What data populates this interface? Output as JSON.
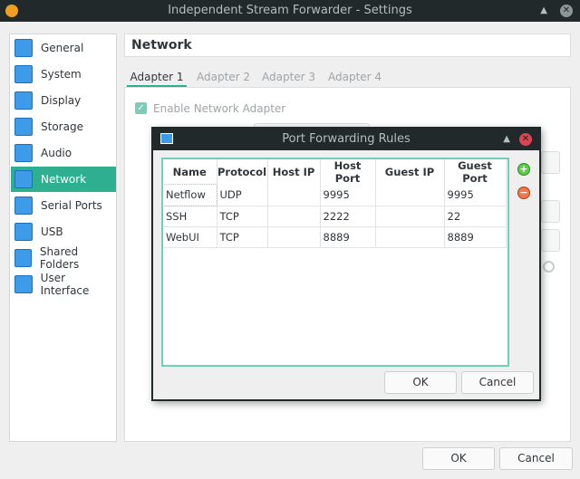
{
  "window": {
    "title": "Independent Stream Forwarder - Settings"
  },
  "sidebar": {
    "items": [
      {
        "label": "General",
        "icon": "general-icon"
      },
      {
        "label": "System",
        "icon": "chip-icon"
      },
      {
        "label": "Display",
        "icon": "monitor-icon"
      },
      {
        "label": "Storage",
        "icon": "storage-icon"
      },
      {
        "label": "Audio",
        "icon": "speaker-icon"
      },
      {
        "label": "Network",
        "icon": "network-icon",
        "active": true
      },
      {
        "label": "Serial Ports",
        "icon": "serial-port-icon"
      },
      {
        "label": "USB",
        "icon": "usb-icon"
      },
      {
        "label": "Shared Folders",
        "icon": "folder-icon"
      },
      {
        "label": "User Interface",
        "icon": "user-interface-icon"
      }
    ]
  },
  "main": {
    "title": "Network",
    "tabs": [
      "Adapter 1",
      "Adapter 2",
      "Adapter 3",
      "Adapter 4"
    ],
    "enable_label": "Enable Network Adapter"
  },
  "footer": {
    "ok": "OK",
    "cancel": "Cancel"
  },
  "dialog": {
    "title": "Port Forwarding Rules",
    "columns": [
      "Name",
      "Protocol",
      "Host IP",
      "Host Port",
      "Guest IP",
      "Guest Port"
    ],
    "rows": [
      [
        "Netflow",
        "UDP",
        "",
        "9995",
        "",
        "9995"
      ],
      [
        "SSH",
        "TCP",
        "",
        "2222",
        "",
        "22"
      ],
      [
        "WebUI",
        "TCP",
        "",
        "8889",
        "",
        "8889"
      ]
    ],
    "ok": "OK",
    "cancel": "Cancel"
  },
  "colors": {
    "accent": "#2eaf8f",
    "titlebar": "#22292b"
  }
}
